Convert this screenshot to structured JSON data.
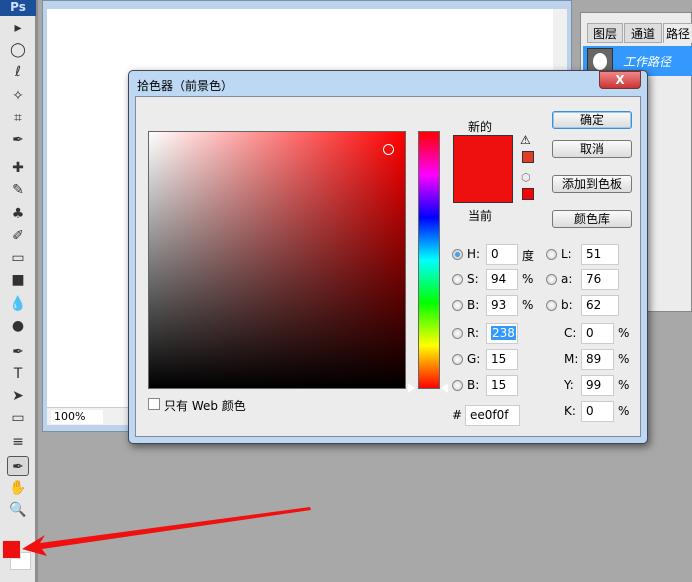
{
  "app": {
    "logo": "Ps",
    "zoom": "100%"
  },
  "tools": [
    "move",
    "marquee",
    "lasso",
    "magic-wand",
    "crop",
    "eyedropper",
    "healing",
    "brush",
    "stamp",
    "history-brush",
    "eraser",
    "gradient",
    "blur",
    "dodge",
    "pen",
    "type",
    "path-select",
    "shape",
    "notes",
    "eyedropper-active",
    "hand",
    "zoom"
  ],
  "panel": {
    "tabs": [
      "图层",
      "通道",
      "路径"
    ],
    "path_name": "工作路径"
  },
  "dialog": {
    "title": "拾色器（前景色）",
    "close": "X",
    "new_label": "新的",
    "current_label": "当前",
    "buttons": {
      "ok": "确定",
      "cancel": "取消",
      "add_swatch": "添加到色板",
      "libraries": "颜色库"
    },
    "web_only": "只有 Web 颜色",
    "fields": {
      "H": {
        "label": "H:",
        "value": "0",
        "unit": "度"
      },
      "S": {
        "label": "S:",
        "value": "94",
        "unit": "%"
      },
      "B": {
        "label": "B:",
        "value": "93",
        "unit": "%"
      },
      "R": {
        "label": "R:",
        "value": "238"
      },
      "G": {
        "label": "G:",
        "value": "15"
      },
      "Bl": {
        "label": "B:",
        "value": "15"
      },
      "L": {
        "label": "L:",
        "value": "51"
      },
      "a": {
        "label": "a:",
        "value": "76"
      },
      "b": {
        "label": "b:",
        "value": "62"
      },
      "C": {
        "label": "C:",
        "value": "0",
        "unit": "%"
      },
      "M": {
        "label": "M:",
        "value": "89",
        "unit": "%"
      },
      "Y": {
        "label": "Y:",
        "value": "99",
        "unit": "%"
      },
      "K": {
        "label": "K:",
        "value": "0",
        "unit": "%"
      },
      "hex": {
        "label": "#",
        "value": "ee0f0f"
      }
    }
  },
  "colors": {
    "foreground": "#ee0f0f",
    "new": "#ee0f0f",
    "current": "#ee0f0f",
    "gamut_warning": "#e03c28",
    "web_safe": "#ff0000"
  }
}
